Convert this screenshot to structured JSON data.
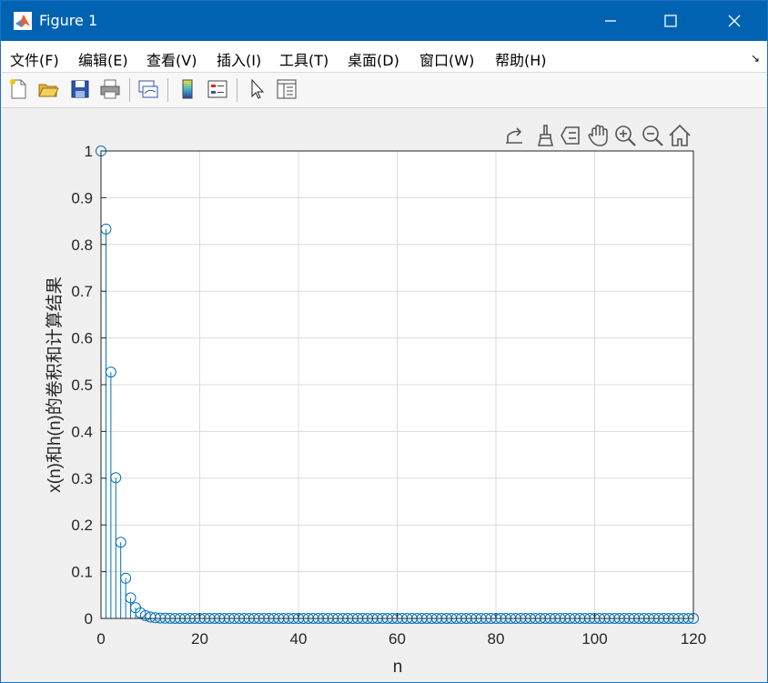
{
  "window": {
    "title": "Figure 1"
  },
  "menu": {
    "items": [
      "文件(F)",
      "编辑(E)",
      "查看(V)",
      "插入(I)",
      "工具(T)",
      "桌面(D)",
      "窗口(W)",
      "帮助(H)"
    ],
    "corner": "↘"
  },
  "toolbar": {
    "buttons": [
      "new-figure-icon",
      "open-file-icon",
      "save-icon",
      "print-icon",
      "link-plot-icon",
      "colorbar-icon",
      "legend-icon",
      "pointer-icon",
      "property-inspector-icon"
    ]
  },
  "axes_toolbar": {
    "buttons": [
      "export-icon",
      "brush-icon",
      "data-tips-icon",
      "pan-icon",
      "zoom-in-icon",
      "zoom-out-icon",
      "home-icon"
    ]
  },
  "colors": {
    "titlebar": "#0063b1",
    "stem": "#0072bd",
    "grid": "#dcdcdc"
  },
  "chart_data": {
    "type": "stem",
    "xlabel": "n",
    "ylabel": "x(n)和h(n)的卷积和计算结果",
    "xlim": [
      0,
      120
    ],
    "ylim": [
      0,
      1
    ],
    "xticks": [
      0,
      20,
      40,
      60,
      80,
      100,
      120
    ],
    "yticks": [
      0,
      0.1,
      0.2,
      0.3,
      0.4,
      0.5,
      0.6,
      0.7,
      0.8,
      0.9,
      1
    ],
    "ytick_labels": [
      "0",
      "0.1",
      "0.2",
      "0.3",
      "0.4",
      "0.5",
      "0.6",
      "0.7",
      "0.8",
      "0.9",
      "1"
    ],
    "grid": true,
    "marker": "open-circle",
    "x_step": 1,
    "values_first": [
      1.0,
      0.833,
      0.527,
      0.301,
      0.163,
      0.086,
      0.044,
      0.023,
      0.012,
      0.006,
      0.003,
      0.0015,
      0.0008,
      0.0004,
      0.0002
    ],
    "tail_value": 0
  }
}
